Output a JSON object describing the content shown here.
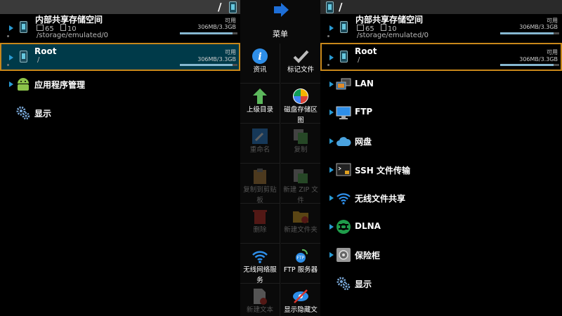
{
  "left_pane": {
    "path": "/",
    "storage": [
      {
        "title": "内部共享存储空间",
        "folders": "65",
        "files": "10",
        "path": "/storage/emulated/0",
        "avail_label": "可用",
        "size": "306MB/3.3GB",
        "used_fraction": 0.91
      },
      {
        "title": "Root",
        "path": "/",
        "avail_label": "可用",
        "size": "306MB/3.3GB",
        "used_fraction": 0.91
      }
    ],
    "items": [
      {
        "label": "应用程序管理",
        "icon": "android-icon"
      },
      {
        "label": "显示",
        "icon": "gears-icon"
      }
    ]
  },
  "menu": {
    "title": "菜单",
    "items": [
      {
        "label": "资讯",
        "icon": "info-icon",
        "enabled": true
      },
      {
        "label": "标记文件",
        "icon": "check-icon",
        "enabled": true
      },
      {
        "label": "上级目录",
        "icon": "up-arrow-icon",
        "enabled": true
      },
      {
        "label": "磁盘存储区图",
        "icon": "pie-chart-icon",
        "enabled": true
      },
      {
        "label": "重命名",
        "icon": "rename-icon",
        "enabled": false
      },
      {
        "label": "复制",
        "icon": "copy-icon",
        "enabled": false
      },
      {
        "label": "复制到剪贴板",
        "icon": "clipboard-icon",
        "enabled": false
      },
      {
        "label": "新建 ZIP 文件",
        "icon": "zip-icon",
        "enabled": false
      },
      {
        "label": "删除",
        "icon": "trash-icon",
        "enabled": false
      },
      {
        "label": "新建文件夹",
        "icon": "new-folder-icon",
        "enabled": false
      },
      {
        "label": "无线网络服务",
        "icon": "wifi-icon",
        "enabled": true
      },
      {
        "label": "FTP 服务器",
        "icon": "ftp-server-icon",
        "enabled": true
      },
      {
        "label": "新建文本",
        "icon": "new-file-icon",
        "enabled": false
      },
      {
        "label": "显示隐藏文",
        "icon": "eye-hidden-icon",
        "enabled": true
      }
    ]
  },
  "right_pane": {
    "path": "/",
    "storage": [
      {
        "title": "内部共享存储空间",
        "folders": "65",
        "files": "10",
        "path": "/storage/emulated/0",
        "avail_label": "可用",
        "size": "306MB/3.3GB",
        "used_fraction": 0.91
      },
      {
        "title": "Root",
        "path": "/",
        "avail_label": "可用",
        "size": "306MB/3.3GB",
        "used_fraction": 0.91
      }
    ],
    "items": [
      {
        "label": "LAN",
        "icon": "lan-icon"
      },
      {
        "label": "FTP",
        "icon": "ftp-monitor-icon"
      },
      {
        "label": "网盘",
        "icon": "cloud-icon"
      },
      {
        "label": "SSH 文件传输",
        "icon": "ssh-terminal-icon"
      },
      {
        "label": "无线文件共享",
        "icon": "wifi-share-icon"
      },
      {
        "label": "DLNA",
        "icon": "dlna-icon"
      },
      {
        "label": "保险柜",
        "icon": "vault-icon"
      },
      {
        "label": "显示",
        "icon": "gears-icon"
      }
    ]
  },
  "colors": {
    "accent": "#2a9bd4",
    "selection_border": "#c8871a",
    "selection_bg": "#003a49"
  }
}
